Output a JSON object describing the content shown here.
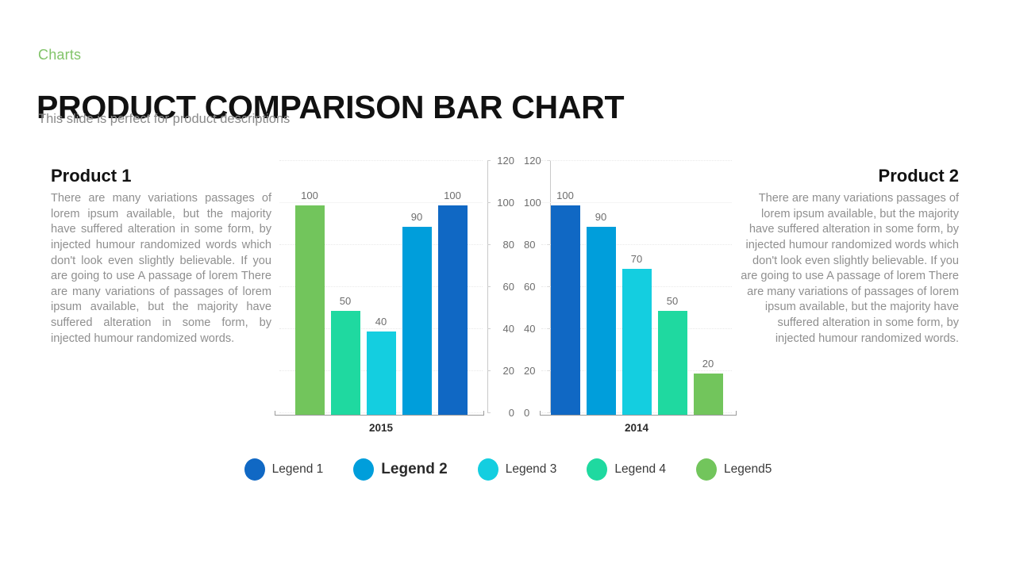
{
  "header": {
    "eyebrow": "Charts",
    "title": "PRODUCT COMPARISON BAR CHART",
    "subtitle": "This slide is perfect for product descriptions",
    "eyebrow_color": "#82c46a"
  },
  "side_left": {
    "heading": "Product 1",
    "body": "There are many variations passages of lorem ipsum available, but the majority have suffered alteration in some form, by injected humour randomized words which don't look even slightly believable. If you are going to use A passage of lorem There are many variations of passages of lorem ipsum available, but the majority have suffered alteration in some form, by injected humour randomized words."
  },
  "side_right": {
    "heading": "Product 2",
    "body": "There are many variations passages of lorem ipsum available, but the majority have suffered alteration in some form, by injected humour randomized words which don't look even slightly believable. If you are going to use A passage of lorem There are many variations of passages of lorem ipsum available, but the majority have suffered alteration in some form, by injected humour randomized words."
  },
  "palette": {
    "legend1_dark_blue": "#1068c4",
    "legend2_blue": "#009edb",
    "legend3_cyan": "#14cee0",
    "legend4_spring_green": "#1fd9a0",
    "legend5_green": "#72c55c"
  },
  "legend": {
    "items": [
      {
        "label": "Legend 1",
        "color": "#1068c4",
        "emphasis": false
      },
      {
        "label": "Legend 2",
        "color": "#009edb",
        "emphasis": true
      },
      {
        "label": "Legend 3",
        "color": "#14cee0",
        "emphasis": false
      },
      {
        "label": "Legend 4",
        "color": "#1fd9a0",
        "emphasis": false
      },
      {
        "label": "Legend5",
        "color": "#72c55c",
        "emphasis": false
      }
    ]
  },
  "chart_data": [
    {
      "type": "bar",
      "title": "2015",
      "categories": [
        "Legend5",
        "Legend 4",
        "Legend 3",
        "Legend 2",
        "Legend 1"
      ],
      "values": [
        100,
        50,
        40,
        90,
        100
      ],
      "data_labels": [
        "100",
        "50",
        "40",
        "90",
        "100"
      ],
      "colors": [
        "#72c55c",
        "#1fd9a0",
        "#14cee0",
        "#009edb",
        "#1068c4"
      ],
      "xlabel": "2015",
      "ylabel": "",
      "ylim": [
        0,
        120
      ],
      "yticks": [
        120,
        100,
        80,
        60,
        40,
        20,
        0
      ],
      "ytick_labels": [
        "120",
        "100",
        "80",
        "60",
        "40",
        "20",
        "0"
      ],
      "axis_side": "right",
      "grid": true,
      "legend_position": "bottom"
    },
    {
      "type": "bar",
      "title": "2014",
      "categories": [
        "Legend 1",
        "Legend 2",
        "Legend 3",
        "Legend 4",
        "Legend5"
      ],
      "values": [
        100,
        90,
        70,
        50,
        20
      ],
      "data_labels": [
        "100",
        "90",
        "70",
        "50",
        "20"
      ],
      "colors": [
        "#1068c4",
        "#009edb",
        "#14cee0",
        "#1fd9a0",
        "#72c55c"
      ],
      "xlabel": "2014",
      "ylabel": "",
      "ylim": [
        0,
        120
      ],
      "yticks": [
        120,
        100,
        80,
        60,
        40,
        20,
        0
      ],
      "ytick_labels": [
        "120",
        "100",
        "80",
        "60",
        "40",
        "20",
        "0"
      ],
      "axis_side": "left",
      "grid": true,
      "legend_position": "bottom"
    }
  ]
}
